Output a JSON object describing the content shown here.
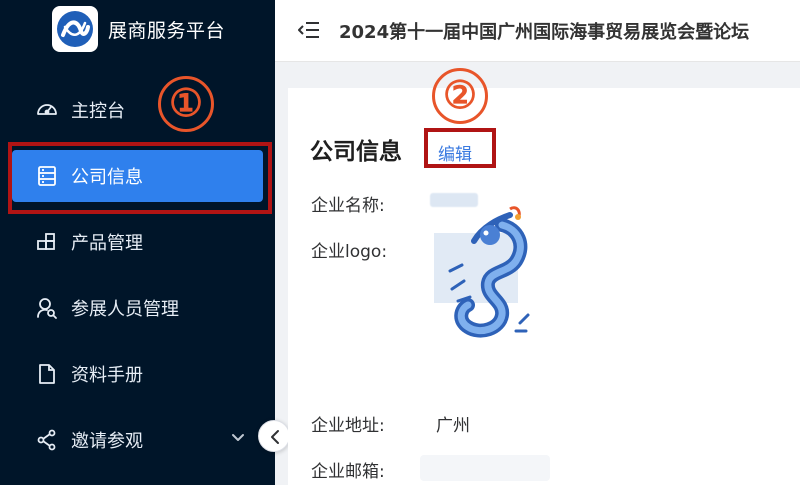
{
  "sidebar": {
    "brand_title": "展商服务平台",
    "items": [
      {
        "label": "主控台",
        "icon": "dashboard-icon"
      },
      {
        "label": "公司信息",
        "icon": "document-list-icon",
        "active": true
      },
      {
        "label": "产品管理",
        "icon": "product-icon"
      },
      {
        "label": "参展人员管理",
        "icon": "user-search-icon"
      },
      {
        "label": "资料手册",
        "icon": "file-icon"
      },
      {
        "label": "邀请参观",
        "icon": "share-icon",
        "has_submenu": true
      }
    ]
  },
  "header": {
    "title": "2024第十一届中国广州国际海事贸易展览会暨论坛"
  },
  "company_info": {
    "title": "公司信息",
    "edit_label": "编辑",
    "fields": {
      "name_label": "企业名称:",
      "name_value": "",
      "logo_label": "企业logo:",
      "address_label": "企业地址:",
      "address_value": "广州",
      "email_label": "企业邮箱:",
      "email_value": ""
    }
  },
  "annotations": {
    "step1": "①",
    "step2": "②"
  },
  "colors": {
    "sidebar_bg": "#001529",
    "active_item": "#2f80ed",
    "link": "#3a7ae0",
    "annotation_box": "#b01414",
    "annotation_number": "#e8552a"
  }
}
